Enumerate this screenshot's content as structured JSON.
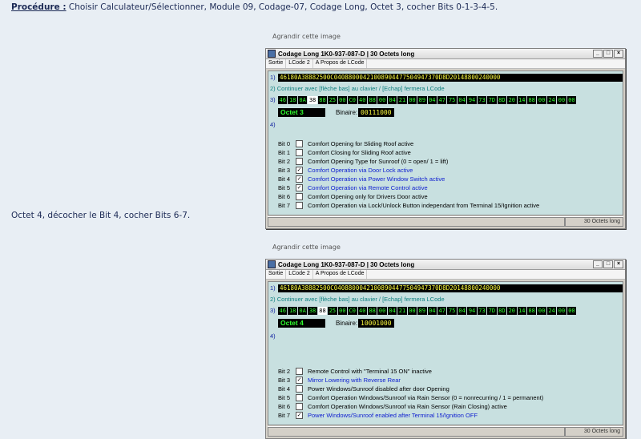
{
  "procedure": {
    "lead": "Procédure :",
    "text": " Choisir Calculateur/Sélectionner, Module 09, Codage-07, Codage Long, Octet 3, cocher Bits 0-1-3-4-5."
  },
  "octet4_text": "Octet 4, décocher le Bit 4, cocher Bits 6-7.",
  "caption": "Agrandir cette image",
  "windows": [
    {
      "title": "Codage Long  1K0-937-087-D | 30 Octets long",
      "menu": [
        "Sortie",
        "LCode 2",
        "A Propos de LCode"
      ],
      "row1_num": "1)",
      "hex": "46180A38882500C04088000421008904477504947370D8D20148800240000",
      "row2": "2) Continuer avec [flèche bas] au clavier / [Echap] fermera LCode",
      "row3_num": "3)",
      "bytes": [
        "46",
        "18",
        "0A",
        "38",
        "88",
        "25",
        "00",
        "C0",
        "40",
        "88",
        "00",
        "04",
        "21",
        "00",
        "89",
        "04",
        "47",
        "75",
        "04",
        "94",
        "73",
        "7D",
        "8D",
        "20",
        "14",
        "88",
        "00",
        "24",
        "00",
        "00"
      ],
      "selected": 3,
      "octet_label": "Octet 3",
      "binaire_label": "Binaire:",
      "binaire": "00111000",
      "row4_num": "4)",
      "bits": [
        {
          "label": "Bit 0",
          "checked": false,
          "desc": "Comfort Opening for Sliding Roof active"
        },
        {
          "label": "Bit 1",
          "checked": false,
          "desc": "Comfort Closing for Sliding Roof active"
        },
        {
          "label": "Bit 2",
          "checked": false,
          "desc": "Comfort Opening Type for Sunroof (0 = open/ 1 = lift)"
        },
        {
          "label": "Bit 3",
          "checked": true,
          "desc": "Comfort Operation via Door Lock active"
        },
        {
          "label": "Bit 4",
          "checked": true,
          "desc": "Comfort Operation via Power Window Switch active"
        },
        {
          "label": "Bit 5",
          "checked": true,
          "desc": "Comfort Operation via Remote Control active"
        },
        {
          "label": "Bit 6",
          "checked": false,
          "desc": "Comfort Opening only for Drivers Door active"
        },
        {
          "label": "Bit 7",
          "checked": false,
          "desc": "Comfort Operation via Lock/Unlock Button independant from Terminal 15/Ignition active"
        }
      ],
      "status": "30 Octets long"
    },
    {
      "title": "Codage Long  1K0-937-087-D | 30 Octets long",
      "menu": [
        "Sortie",
        "LCode 2",
        "A Propos de LCode"
      ],
      "row1_num": "1)",
      "hex": "46180A38882500C04088000421008904477504947370D8D20148800240000",
      "row2": "2) Continuer avec [flèche bas] au clavier / [Echap] fermera LCode",
      "row3_num": "3)",
      "bytes": [
        "46",
        "18",
        "0A",
        "38",
        "88",
        "25",
        "00",
        "C0",
        "40",
        "88",
        "00",
        "04",
        "21",
        "00",
        "89",
        "04",
        "47",
        "75",
        "04",
        "94",
        "73",
        "7D",
        "8D",
        "20",
        "14",
        "88",
        "00",
        "24",
        "00",
        "00"
      ],
      "selected": 4,
      "octet_label": "Octet 4",
      "binaire_label": "Binaire:",
      "binaire": "10001000",
      "row4_num": "4)",
      "bits": [
        {
          "label": "Bit 2",
          "checked": false,
          "desc": "Remote Control with \"Terminal 15 ON\" inactive"
        },
        {
          "label": "Bit 3",
          "checked": true,
          "desc": "Mirror Lowering with Reverse Rear"
        },
        {
          "label": "Bit 4",
          "checked": false,
          "desc": "Power Windows/Sunroof disabled after door Opening"
        },
        {
          "label": "Bit 5",
          "checked": false,
          "desc": "Comfort Operation Windows/Sunroof via Rain Sensor (0 = nonrecurring / 1 = permanent)"
        },
        {
          "label": "Bit 6",
          "checked": false,
          "desc": "Comfort Operation Windows/Sunroof via Rain Sensor (Rain Closing) active"
        },
        {
          "label": "Bit 7",
          "checked": true,
          "desc": "Power Windows/Sunroof enabled after Terminal 15/Ignition OFF"
        }
      ],
      "status": "30 Octets long"
    }
  ]
}
